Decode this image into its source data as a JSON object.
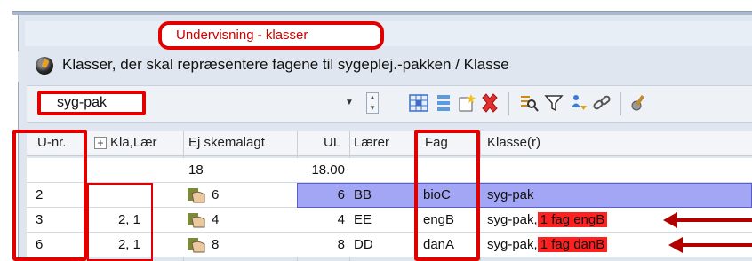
{
  "tab": {
    "label": "Undervisning - klasser"
  },
  "window": {
    "title": "Klasser, der skal repræsentere fagene til sygeplej.-pakken / Klasse"
  },
  "toolbar": {
    "combo_value": "syg-pak"
  },
  "table": {
    "headers": {
      "unr": "U-nr.",
      "kla": "Kla,Lær",
      "ej": "Ej skemalagt",
      "ul": "UL",
      "laerer": "Lærer",
      "fag": "Fag",
      "klasse": "Klasse(r)"
    },
    "expand_glyph": "+",
    "totals": {
      "ej": "18",
      "ul": "18.00"
    },
    "rows": [
      {
        "unr": "2",
        "kla": "",
        "ej": "6",
        "ul": "6",
        "laerer": "BB",
        "fag": "bioC",
        "klasse": "syg-pak",
        "extra": ""
      },
      {
        "unr": "3",
        "kla": "2, 1",
        "ej": "4",
        "ul": "4",
        "laerer": "EE",
        "fag": "engB",
        "klasse": "syg-pak,",
        "extra": "1 fag engB"
      },
      {
        "unr": "6",
        "kla": "2, 1",
        "ej": "8",
        "ul": "8",
        "laerer": "DD",
        "fag": "danA",
        "klasse": "syg-pak,",
        "extra": "1 fag danB"
      }
    ]
  },
  "colors": {
    "annotation_red": "#e00000",
    "selection": "#a3a5f5",
    "arrow": "#b00000"
  }
}
